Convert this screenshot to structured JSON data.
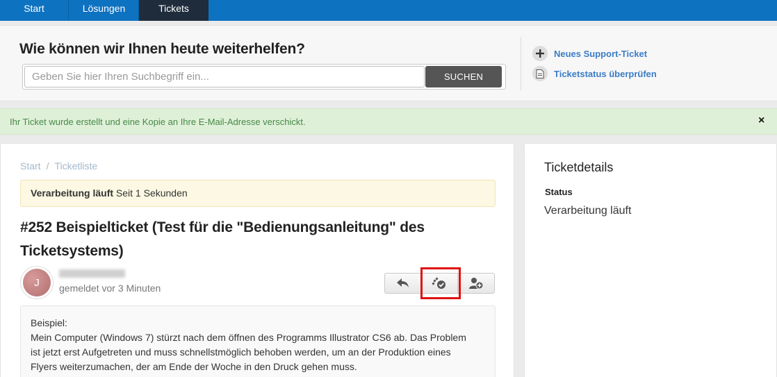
{
  "nav": {
    "tabs": [
      {
        "label": "Start"
      },
      {
        "label": "Lösungen"
      },
      {
        "label": "Tickets"
      }
    ]
  },
  "search": {
    "heading": "Wie können wir Ihnen heute weiterhelfen?",
    "placeholder": "Geben Sie hier Ihren Suchbegriff ein...",
    "button_label": "SUCHEN"
  },
  "side_links": [
    {
      "label": "Neues Support-Ticket",
      "icon": "plus-icon"
    },
    {
      "label": "Ticketstatus überprüfen",
      "icon": "document-icon"
    }
  ],
  "alert": {
    "message": "Ihr Ticket wurde erstellt und eine Kopie an Ihre E-Mail-Adresse verschickt.",
    "close": "×"
  },
  "breadcrumb": {
    "items": [
      "Start",
      "Ticketliste"
    ],
    "separator": "/"
  },
  "status_bar": {
    "label": "Verarbeitung läuft",
    "since": "Seit 1 Sekunden"
  },
  "ticket": {
    "title": "#252 Beispielticket (Test für die \"Bedienungsanleitung\" des Ticketsystems)",
    "avatar_initial": "J",
    "reported": "gemeldet vor 3 Minuten",
    "body_lines": [
      "Beispiel:",
      "Mein Computer (Windows 7) stürzt nach dem öffnen des Programms Illustrator CS6 ab. Das Problem",
      "ist jetzt erst Aufgetreten und muss schnellstmöglich behoben werden, um an der Produktion eines",
      "Flyers weiterzumachen, der am Ende der Woche in den Druck gehen muss."
    ]
  },
  "details": {
    "heading": "Ticketdetails",
    "status_key": "Status",
    "status_value": "Verarbeitung läuft"
  },
  "colors": {
    "nav": "#0d72c0",
    "nav_active": "#1f2c3b",
    "link": "#3b7cc6",
    "alert_bg": "#dff0d8",
    "alert_text": "#468847",
    "status_bg": "#fcf8e3",
    "highlight": "#e01010"
  }
}
